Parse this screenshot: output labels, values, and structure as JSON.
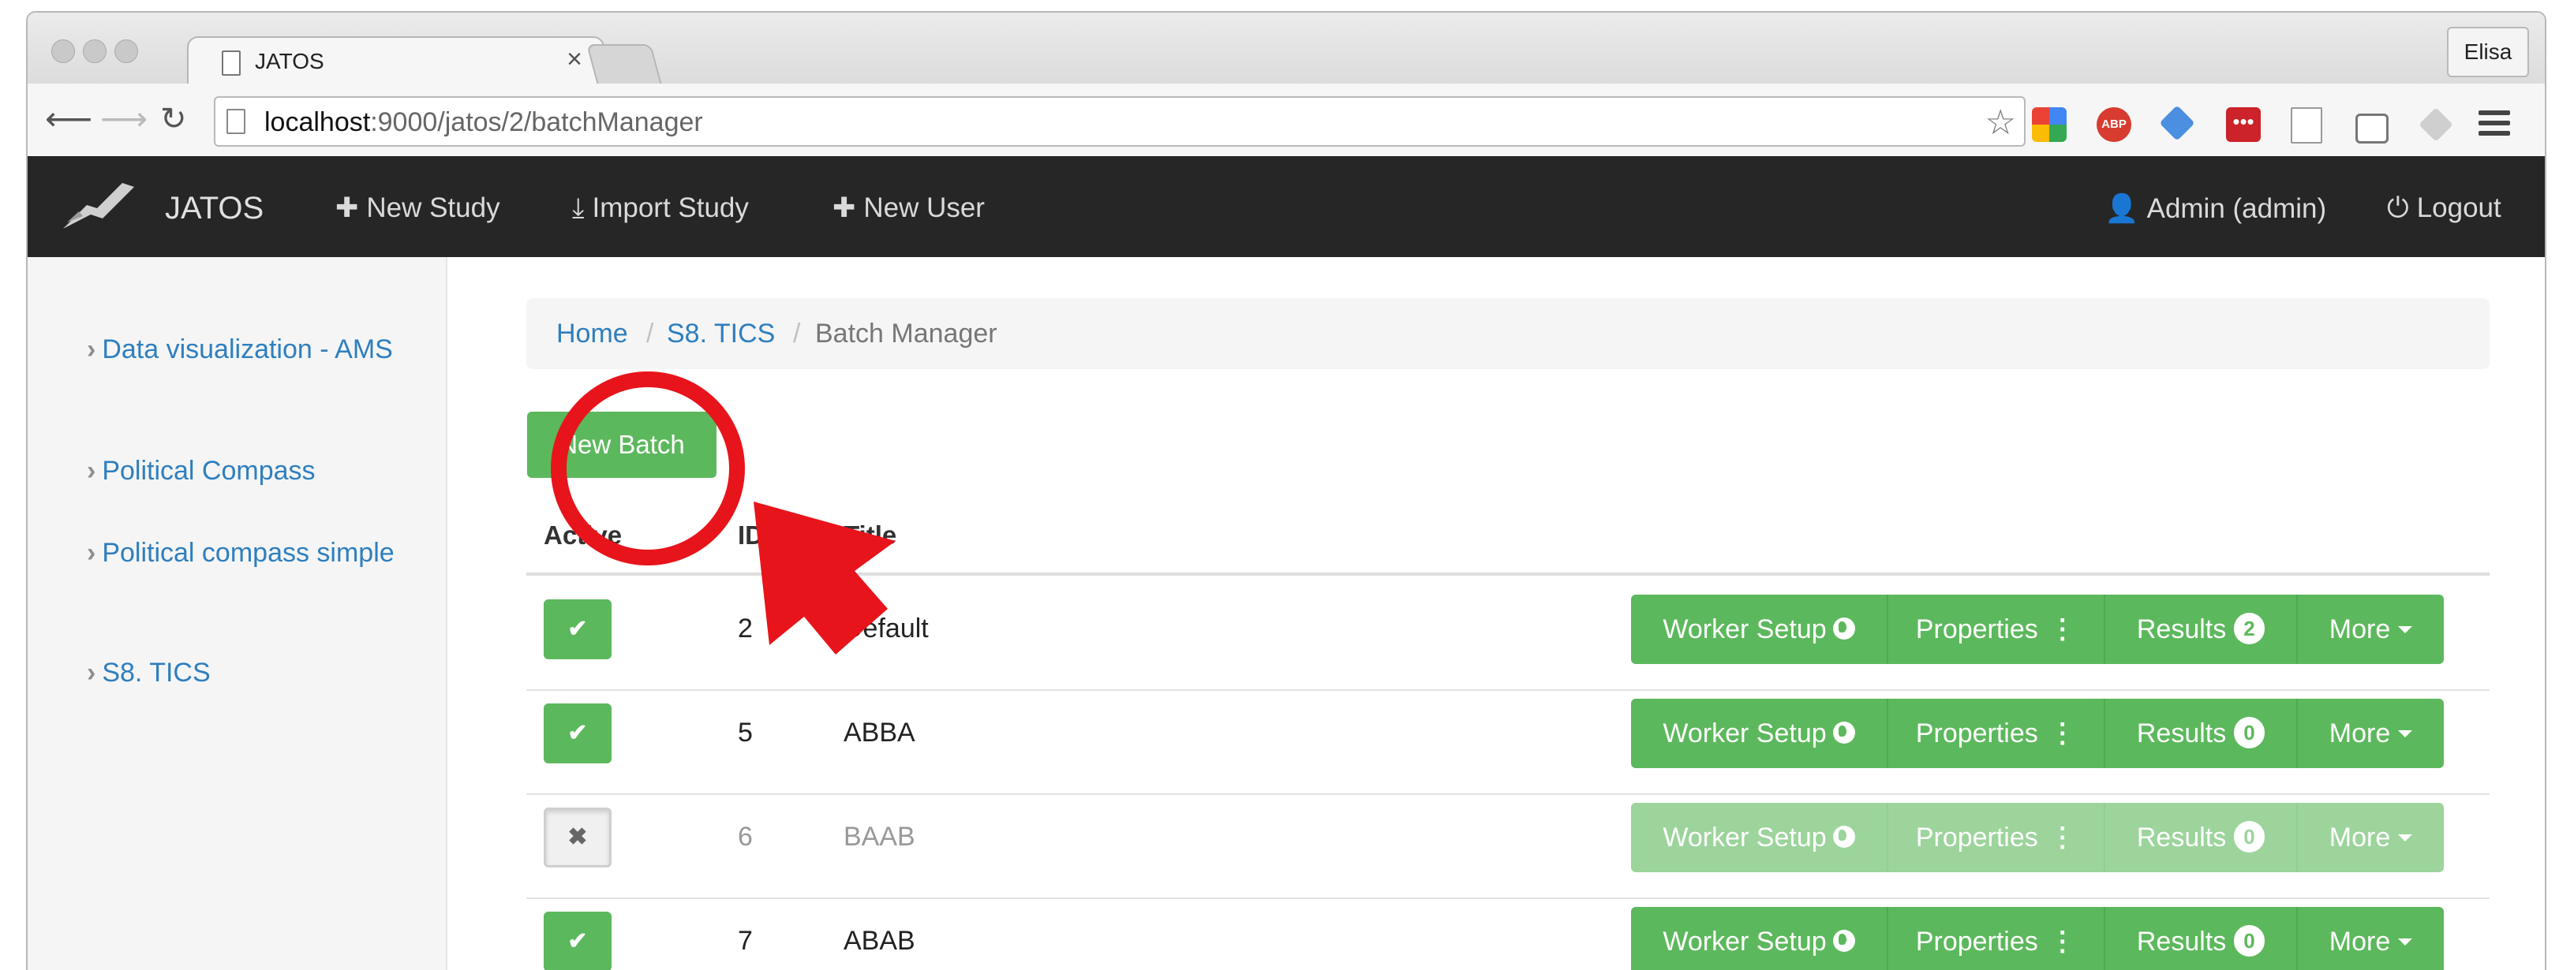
{
  "browser": {
    "tab_title": "JATOS",
    "tab_close": "×",
    "profile_name": "Elisa",
    "url_host": "localhost",
    "url_path": ":9000/jatos/2/batchManager",
    "star": "☆",
    "abp_label": "ABP",
    "dots_label": "•••"
  },
  "navbar": {
    "brand": "JATOS",
    "new_study": "New Study",
    "import_study": "Import Study",
    "new_user": "New User",
    "user": "Admin (admin)",
    "logout": "Logout"
  },
  "sidebar": {
    "items": [
      {
        "label": "Data visualization - AMS"
      },
      {
        "label": "Political Compass"
      },
      {
        "label": "Political compass simple"
      },
      {
        "label": "S8. TICS"
      }
    ]
  },
  "breadcrumb": {
    "home": "Home",
    "study": "S8. TICS",
    "current": "Batch Manager",
    "separator": "/"
  },
  "new_batch_label": "New Batch",
  "table": {
    "headers": {
      "active": "Active",
      "id": "ID",
      "title": "Title"
    },
    "rows": [
      {
        "active": true,
        "id": "2",
        "title": "Default",
        "results": "2"
      },
      {
        "active": true,
        "id": "5",
        "title": "ABBA",
        "results": "0"
      },
      {
        "active": false,
        "id": "6",
        "title": "BAAB",
        "results": "0"
      },
      {
        "active": true,
        "id": "7",
        "title": "ABAB",
        "results": "0"
      }
    ],
    "buttons": {
      "worker_setup": "Worker Setup",
      "properties": "Properties",
      "results": "Results",
      "more": "More"
    },
    "check_on": "✔",
    "check_off": "✖"
  },
  "colors": {
    "success": "#5cb85c",
    "link": "#2e7fbf",
    "navbar_bg": "#262626",
    "annotation_red": "#e8141b"
  }
}
